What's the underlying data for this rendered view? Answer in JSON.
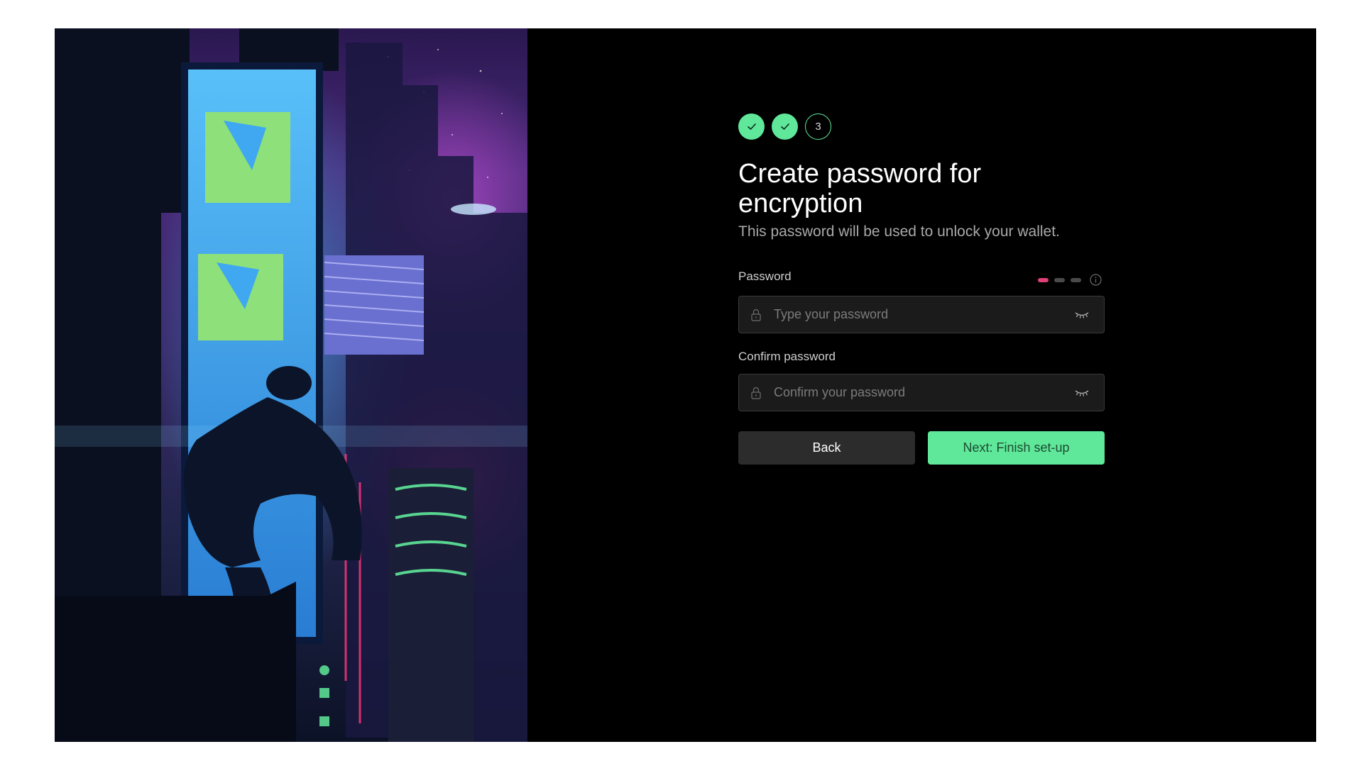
{
  "stepper": {
    "steps": [
      {
        "state": "done",
        "icon": "check-icon"
      },
      {
        "state": "done",
        "icon": "check-icon"
      },
      {
        "state": "current",
        "label": "3"
      }
    ]
  },
  "header": {
    "title": "Create password for encryption",
    "subtitle": "This password will be used to unlock your wallet."
  },
  "password": {
    "label": "Password",
    "placeholder": "Type your password",
    "value": "",
    "strength_level": 1,
    "strength_segments": 3,
    "strength_color": "#e0407a"
  },
  "confirm": {
    "label": "Confirm password",
    "placeholder": "Confirm your password",
    "value": ""
  },
  "actions": {
    "back_label": "Back",
    "next_label": "Next: Finish set-up"
  },
  "colors": {
    "accent": "#5fe89a",
    "background": "#000000",
    "field_bg": "#1b1b1b"
  }
}
